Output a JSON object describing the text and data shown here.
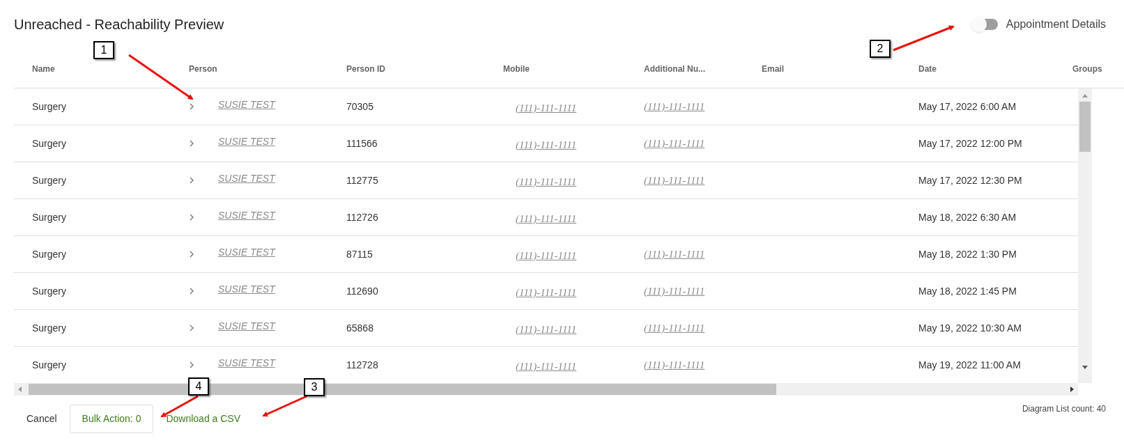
{
  "title": "Unreached - Reachability Preview",
  "toggle": {
    "label": "Appointment Details",
    "on": false
  },
  "table": {
    "columns": [
      "Name",
      "Person",
      "Person ID",
      "Mobile",
      "Additional Nu...",
      "Email",
      "Date",
      "Groups"
    ],
    "rows": [
      {
        "name": "Surgery",
        "person": "SUSIE TEST",
        "person_id": "70305",
        "mobile": "(111)-111-1111",
        "additional": "(111)-111-1111",
        "date": "May 17, 2022 6:00 AM"
      },
      {
        "name": "Surgery",
        "person": "SUSIE TEST",
        "person_id": "111566",
        "mobile": "(111)-111-1111",
        "additional": "(111)-111-1111",
        "date": "May 17, 2022 12:00 PM"
      },
      {
        "name": "Surgery",
        "person": "SUSIE TEST",
        "person_id": "112775",
        "mobile": "(111)-111-1111",
        "additional": "(111)-111-1111",
        "date": "May 17, 2022 12:30 PM"
      },
      {
        "name": "Surgery",
        "person": "SUSIE TEST",
        "person_id": "112726",
        "mobile": "(111)-111-1111",
        "date": "May 18, 2022 6:30 AM"
      },
      {
        "name": "Surgery",
        "person": "SUSIE TEST",
        "person_id": "87115",
        "mobile": "(111)-111-1111",
        "additional": "(111)-111-1111",
        "date": "May 18, 2022 1:30 PM"
      },
      {
        "name": "Surgery",
        "person": "SUSIE TEST",
        "person_id": "112690",
        "mobile": "(111)-111-1111",
        "additional": "(111)-111-1111",
        "date": "May 18, 2022 1:45 PM"
      },
      {
        "name": "Surgery",
        "person": "SUSIE TEST",
        "person_id": "65868",
        "mobile": "(111)-111-1111",
        "additional": "(111)-111-1111",
        "date": "May 19, 2022 10:30 AM"
      },
      {
        "name": "Surgery",
        "person": "SUSIE TEST",
        "person_id": "112728",
        "mobile": "(111)-111-1111",
        "additional": "(111)-111-1111",
        "date": "May 19, 2022 11:00 AM"
      }
    ]
  },
  "footer": {
    "cancel": "Cancel",
    "bulk_action": "Bulk Action: 0",
    "download": "Download a CSV",
    "count": "Diagram List count: 40"
  },
  "callouts": [
    {
      "label": "1"
    },
    {
      "label": "2"
    },
    {
      "label": "3"
    },
    {
      "label": "4"
    }
  ]
}
